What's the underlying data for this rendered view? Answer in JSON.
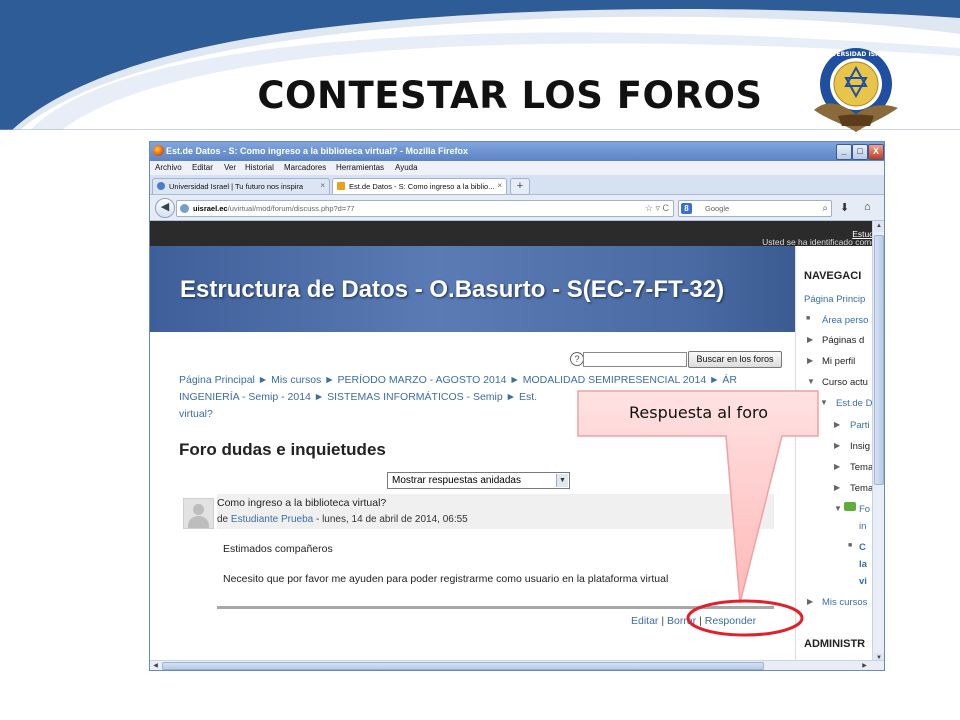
{
  "slide": {
    "title": "CONTESTAR LOS FOROS",
    "logo_text": "UNIVERSIDAD ISRAEL"
  },
  "browser": {
    "window_title": "Est.de Datos - S: Como ingreso a la biblioteca virtual? - Mozilla Firefox",
    "menu": [
      "Archivo",
      "Editar",
      "Ver",
      "Historial",
      "Marcadores",
      "Herramientas",
      "Ayuda"
    ],
    "tabs": [
      {
        "label": "Universidad Israel | Tu futuro nos inspira",
        "close": "×"
      },
      {
        "label": "Est.de Datos - S: Como ingreso a la biblio...",
        "close": "×"
      }
    ],
    "new_tab": "+",
    "url_domain": "uisrael.ec",
    "url_path": "/uvirtual/mod/forum/discuss.php?d=77",
    "search_engine_badge": "8",
    "search_placeholder": "Google",
    "window_buttons": {
      "minimize": "_",
      "maximize": "□",
      "close": "X"
    }
  },
  "site": {
    "logged_in_prefix": "Usted se ha identificado como ",
    "logged_in_user": "Estud",
    "course_title": "Estructura de Datos - O.Basurto - S(EC-7-FT-32)"
  },
  "forum": {
    "search_button": "Buscar en los foros",
    "breadcrumb_line1": "Página Principal ► Mis cursos ► PERÍODO MARZO - AGOSTO 2014 ► MODALIDAD SEMIPRESENCIAL 2014 ► ÁR",
    "breadcrumb_line2": "INGENIERÍA - Semip - 2014 ► SISTEMAS INFORMÁTICOS - Semip ► Est.",
    "breadcrumb_line3": "virtual?",
    "heading": "Foro dudas e inquietudes",
    "display_mode": "Mostrar respuestas anidadas",
    "post": {
      "subject": "Como ingreso a la biblioteca virtual?",
      "by_prefix": "de ",
      "author": "Estudiante Prueba",
      "date": " - lunes, 14 de abril de 2014, 06:55",
      "body_line1": "Estimados compañeros",
      "body_line2": "Necesito que por favor me ayuden para poder registrarme como usuario en la plataforma virtual"
    },
    "commands": {
      "edit": "Editar",
      "sep": " | ",
      "delete": "Borrar",
      "reply": "Responder"
    }
  },
  "sidebar": {
    "nav_heading": "NAVEGACI",
    "items": [
      {
        "text": "Página Princip",
        "style": "link"
      },
      {
        "text": "Área perso",
        "style": "link"
      },
      {
        "text": "Páginas d",
        "style": "dark"
      },
      {
        "text": "Mi perfil",
        "style": "dark"
      },
      {
        "text": "Curso actu",
        "style": "dark"
      },
      {
        "text": "Est.de D",
        "style": "link"
      },
      {
        "text": "Parti",
        "style": "link"
      },
      {
        "text": "Insig",
        "style": "dark"
      },
      {
        "text": "Tema",
        "style": "dark"
      },
      {
        "text": "Tema",
        "style": "dark"
      },
      {
        "text": "Fo",
        "style": "link"
      },
      {
        "text": "in",
        "style": "link"
      },
      {
        "text": "C",
        "style": "link"
      },
      {
        "text": "la",
        "style": "link"
      },
      {
        "text": "vi",
        "style": "link"
      },
      {
        "text": "Mis cursos",
        "style": "link"
      }
    ],
    "admin_heading": "ADMINISTR"
  },
  "annotation": {
    "callout_text": "Respuesta al foro",
    "callout_fill": "#ffc8c8",
    "highlight_color": "#e0202b"
  },
  "colors": {
    "slide_swoosh": "#2e5c96",
    "banner": "#4a6aa3",
    "link": "#3a6ea5"
  }
}
